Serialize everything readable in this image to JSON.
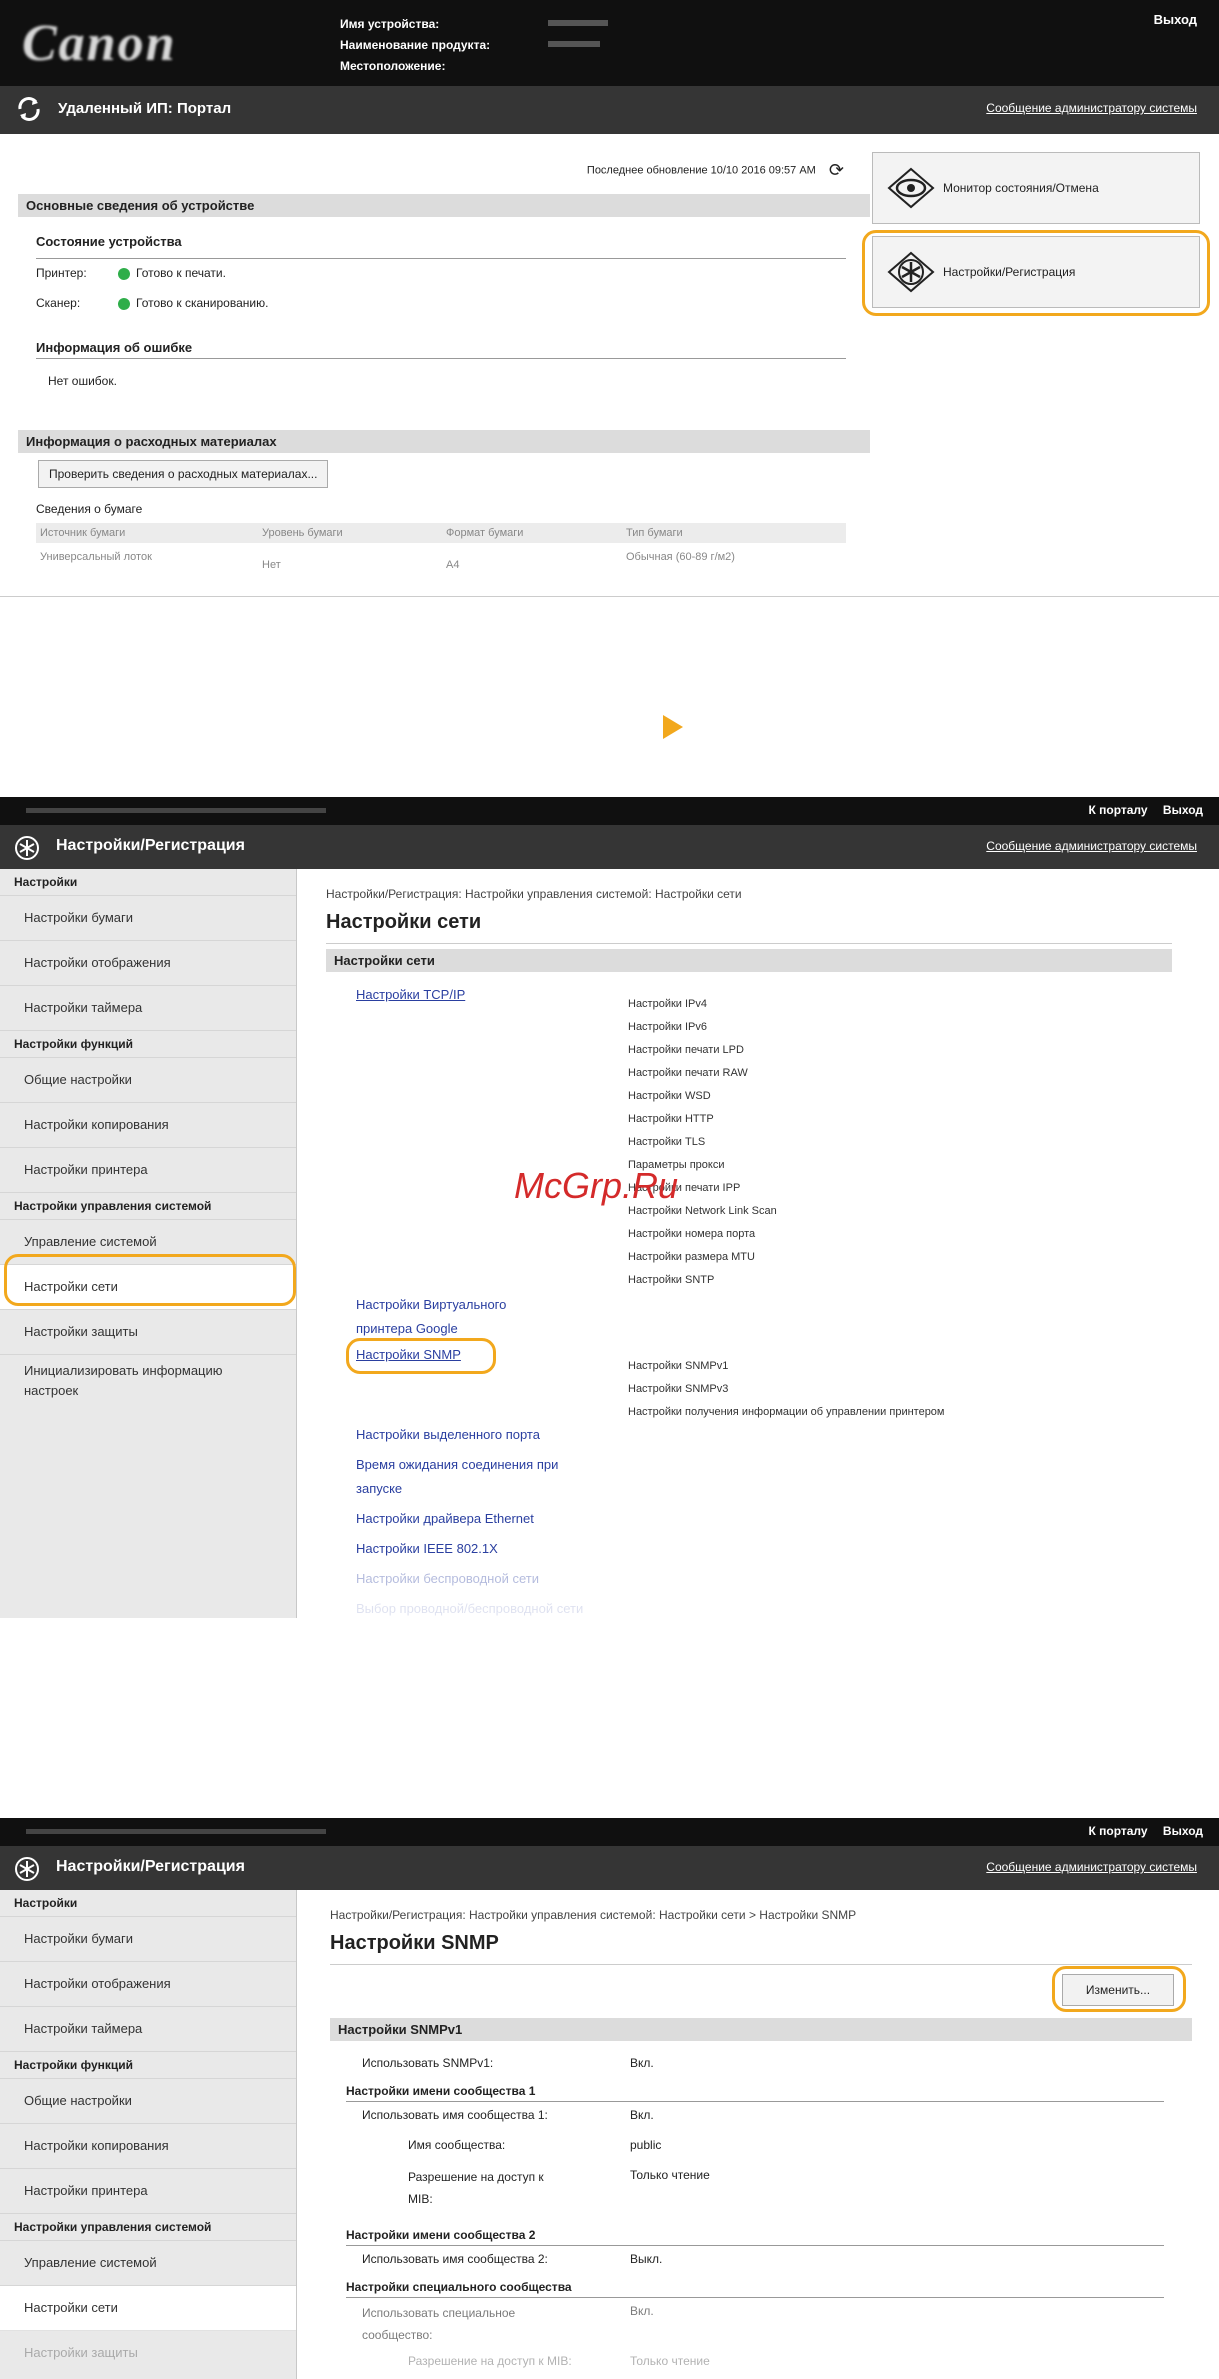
{
  "shot1": {
    "logo": "Canon",
    "device_labels": [
      "Имя устройства:",
      "Наименование продукта:",
      "Местоположение:"
    ],
    "logout": "Выход",
    "portal_title": "Удаленный ИП: Портал",
    "admin_msg": "Сообщение администратору системы",
    "last_updated": "Последнее обновление 10/10 2016 09:57 AM",
    "basic_info_header": "Основные сведения об устройстве",
    "device_status_title": "Состояние устройства",
    "printer_label": "Принтер:",
    "printer_status": "Готово к печати.",
    "scanner_label": "Сканер:",
    "scanner_status": "Готово к сканированию.",
    "error_info_title": "Информация об ошибке",
    "no_errors": "Нет ошибок.",
    "consumables_header": "Информация о расходных материалах",
    "check_consumables_button": "Проверить сведения о расходных материалах...",
    "paper_info_title": "Сведения о бумаге",
    "paper_table": {
      "headers": [
        "Источник бумаги",
        "Уровень бумаги",
        "Формат бумаги",
        "Тип бумаги"
      ],
      "row": [
        "Универсальный лоток",
        "Нет",
        "A4",
        "Обычная (60-89 г/м2)"
      ]
    },
    "status_monitor_button": "Монитор состояния/Отмена",
    "settings_button": "Настройки/Регистрация",
    "status_color": "#2fae4a",
    "highlight_color": "#f2a81d"
  },
  "shot2": {
    "to_portal": "К порталу",
    "logout": "Выход",
    "title": "Настройки/Регистрация",
    "admin_msg": "Сообщение администратору системы",
    "sidebar": [
      {
        "group": "Настройки",
        "items": [
          "Настройки бумаги",
          "Настройки отображения",
          "Настройки таймера"
        ]
      },
      {
        "group": "Настройки функций",
        "items": [
          "Общие настройки",
          "Настройки копирования",
          "Настройки принтера"
        ]
      },
      {
        "group": "Настройки управления системой",
        "items": [
          "Управление системой",
          "Настройки сети",
          "Настройки защиты",
          "Инициализировать информацию настроек"
        ]
      }
    ],
    "breadcrumb": "Настройки/Регистрация: Настройки управления системой: Настройки сети",
    "page_title": "Настройки сети",
    "section": "Настройки сети",
    "tcpip_link": "Настройки TCP/IP",
    "tcpip_items": [
      "Настройки IPv4",
      "Настройки IPv6",
      "Настройки печати LPD",
      "Настройки печати RAW",
      "Настройки WSD",
      "Настройки HTTP",
      "Настройки TLS",
      "Параметры прокси",
      "Настройки печати IPP",
      "Настройки Network Link Scan",
      "Настройки номера порта",
      "Настройки размера MTU",
      "Настройки SNTP"
    ],
    "watermark": "McGrp.Ru",
    "virtual_link": "Настройки Виртуального принтера Google",
    "snmp_link": "Настройки SNMP",
    "snmp_items": [
      "Настройки SNMPv1",
      "Настройки SNMPv3",
      "Настройки получения информации об управлении принтером"
    ],
    "other_links": [
      "Настройки выделенного порта",
      "Время ожидания соединения при запуске",
      "Настройки драйвера Ethernet",
      "Настройки IEEE 802.1X",
      "Настройки беспроводной сети",
      "Выбор проводной/беспроводной сети"
    ]
  },
  "shot3": {
    "to_portal": "К порталу",
    "logout": "Выход",
    "title": "Настройки/Регистрация",
    "admin_msg": "Сообщение администратору системы",
    "sidebar": [
      {
        "group": "Настройки",
        "items": [
          "Настройки бумаги",
          "Настройки отображения",
          "Настройки таймера"
        ]
      },
      {
        "group": "Настройки функций",
        "items": [
          "Общие настройки",
          "Настройки копирования",
          "Настройки принтера"
        ]
      },
      {
        "group": "Настройки управления системой",
        "items": [
          "Управление системой",
          "Настройки сети",
          "Настройки защиты"
        ]
      }
    ],
    "breadcrumb": "Настройки/Регистрация: Настройки управления системой: Настройки сети > Настройки SNMP",
    "page_title": "Настройки SNMP",
    "edit_button": "Изменить...",
    "v1_header": "Настройки SNMPv1",
    "use_v1_label": "Использовать SNMPv1:",
    "use_v1_value": "Вкл.",
    "comm1_title": "Настройки имени сообщества 1",
    "use_comm1_label": "Использовать имя сообщества 1:",
    "use_comm1_value": "Вкл.",
    "comm_name_label": "Имя сообщества:",
    "comm_name_value": "public",
    "mib_label": "Разрешение на доступ к MIB:",
    "mib_value": "Только чтение",
    "comm2_title": "Настройки имени сообщества 2",
    "use_comm2_label": "Использовать имя сообщества 2:",
    "use_comm2_value": "Выкл.",
    "special_title": "Настройки специального сообщества",
    "use_special_label": "Использовать специальное сообщество:",
    "use_special_value": "Вкл.",
    "special_mib_label": "Разрешение на доступ к MIB:",
    "special_mib_value": "Только чтение"
  }
}
